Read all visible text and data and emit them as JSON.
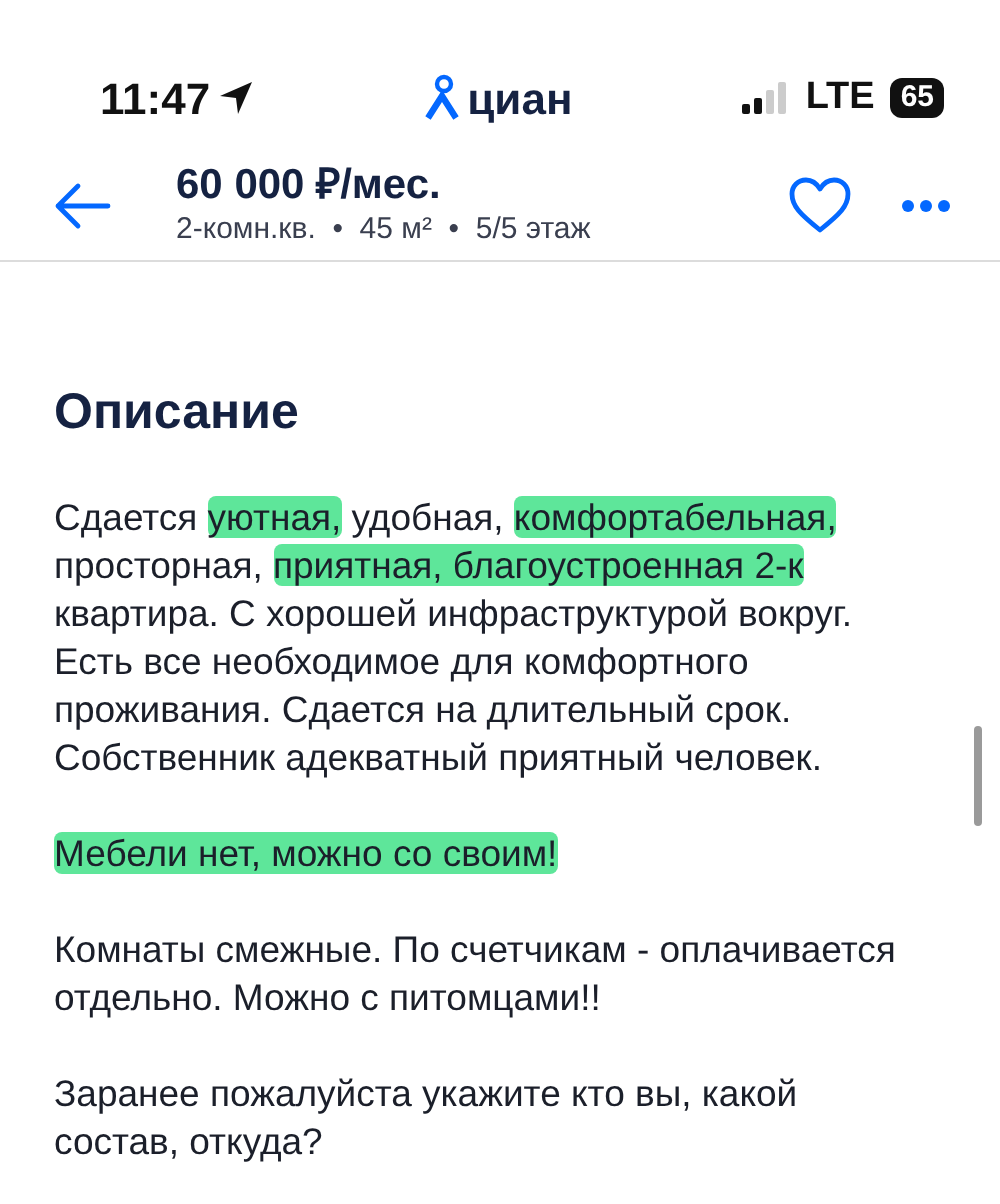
{
  "status_bar": {
    "time": "11:47",
    "carrier_logo": "циан",
    "network": "LTE",
    "battery": "65"
  },
  "header": {
    "price": "60 000 ₽/мес.",
    "details": [
      "2-комн.кв.",
      "45 м²",
      "5/5 этаж"
    ],
    "separator": "•",
    "favorite": false
  },
  "section_title": "Описание",
  "paragraphs": [
    {
      "segments": [
        {
          "text": "Сдается ",
          "highlighted": false
        },
        {
          "text": "уютная,",
          "highlighted": true
        },
        {
          "text": " удобная, ",
          "highlighted": false
        },
        {
          "text": "комфортабельная,",
          "highlighted": true
        },
        {
          "text": " просторная, ",
          "highlighted": false
        },
        {
          "text": "приятная, благоустроенная 2-к",
          "highlighted": true
        },
        {
          "text": " квартира. С хорошей инфраструктурой вокруг. Есть все необходимое для комфортного проживания. Сдается на длительный срок. Собственник адекватный приятный человек.",
          "highlighted": false
        }
      ]
    },
    {
      "segments": [
        {
          "text": "Мебели нет, можно со своим!",
          "highlighted": true
        }
      ]
    },
    {
      "segments": [
        {
          "text": "Комнаты смежные. По счетчикам - оплачивается отдельно. Можно с питомцами!!",
          "highlighted": false
        }
      ]
    },
    {
      "segments": [
        {
          "text": "Заранее пожалуйста укажите кто вы, какой состав, откуда?",
          "highlighted": false
        }
      ]
    }
  ]
}
